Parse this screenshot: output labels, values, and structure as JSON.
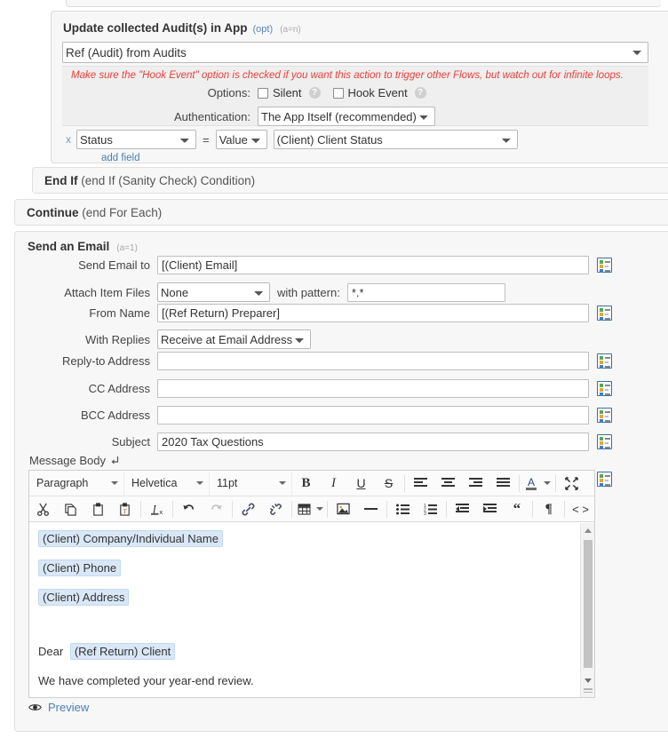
{
  "update_block": {
    "title": "Update collected Audit(s) in App",
    "title_opt": "(opt)",
    "title_an": "(a=n)",
    "source_select": "Ref (Audit) from Audits",
    "warning": "Make sure the \"Hook Event\" option is checked if you want this action to trigger other Flows, but watch out for infinite loops.",
    "options_label": "Options:",
    "silent_label": "Silent",
    "hook_event_label": "Hook Event",
    "help_glyph": "?",
    "auth_label": "Authentication:",
    "auth_value": "The App Itself (recommended)",
    "field_remove": "x",
    "field_name": "Status",
    "field_eq": "=",
    "field_op": "Value",
    "field_value": "(Client) Client Status",
    "add_field": "add field"
  },
  "end_if": {
    "title": "End If",
    "detail": "(end If (Sanity Check) Condition)"
  },
  "continue": {
    "title": "Continue",
    "detail": "(end For Each)"
  },
  "email": {
    "title": "Send an Email",
    "title_an": "(a=1)",
    "send_to_label": "Send Email to",
    "send_to_value": "[(Client) Email]",
    "attach_label": "Attach Item Files",
    "attach_value": "None",
    "pattern_label": "with pattern:",
    "pattern_value": "*.*",
    "from_name_label": "From Name",
    "from_name_value": "[(Ref Return) Preparer]",
    "with_replies_label": "With Replies",
    "with_replies_value": "Receive at Email Address",
    "reply_to_label": "Reply-to Address",
    "reply_to_value": "",
    "cc_label": "CC Address",
    "cc_value": "",
    "bcc_label": "BCC Address",
    "bcc_value": "",
    "subject_label": "Subject",
    "subject_value": "2020 Tax Questions",
    "message_body_label": "Message Body"
  },
  "editor": {
    "block_format": "Paragraph",
    "font_family": "Helvetica",
    "font_size": "11pt",
    "toolbar_row1": [
      "bold-icon",
      "italic-icon",
      "underline-icon",
      "strikethrough-icon",
      "align-left-icon",
      "align-center-icon",
      "align-right-icon",
      "align-justify-icon",
      "text-color-icon",
      "fullscreen-icon"
    ],
    "toolbar_row2": [
      "cut-icon",
      "copy-icon",
      "paste-icon",
      "paste-as-text-icon",
      "clear-formatting-icon",
      "undo-icon",
      "redo-icon",
      "link-icon",
      "unlink-icon",
      "table-icon",
      "image-icon",
      "horizontal-rule-icon",
      "bullet-list-icon",
      "numbered-list-icon",
      "outdent-icon",
      "indent-icon",
      "blockquote-icon",
      "show-invisibles-icon",
      "source-code-icon"
    ],
    "content": {
      "token_company": "(Client) Company/Individual Name",
      "token_phone": "(Client) Phone",
      "token_address": "(Client) Address",
      "greeting": "Dear",
      "token_client": "(Ref Return) Client",
      "line_closing": "We have completed your year-end review."
    }
  },
  "preview": {
    "label": "Preview",
    "icon": "eye-icon"
  },
  "colors": {
    "token_bg": "#d9e7f7",
    "warning": "#e8403a",
    "link": "#4a7fb5",
    "panel_bg": "#f7f7f7",
    "picker_border": "#3f6c9e"
  }
}
